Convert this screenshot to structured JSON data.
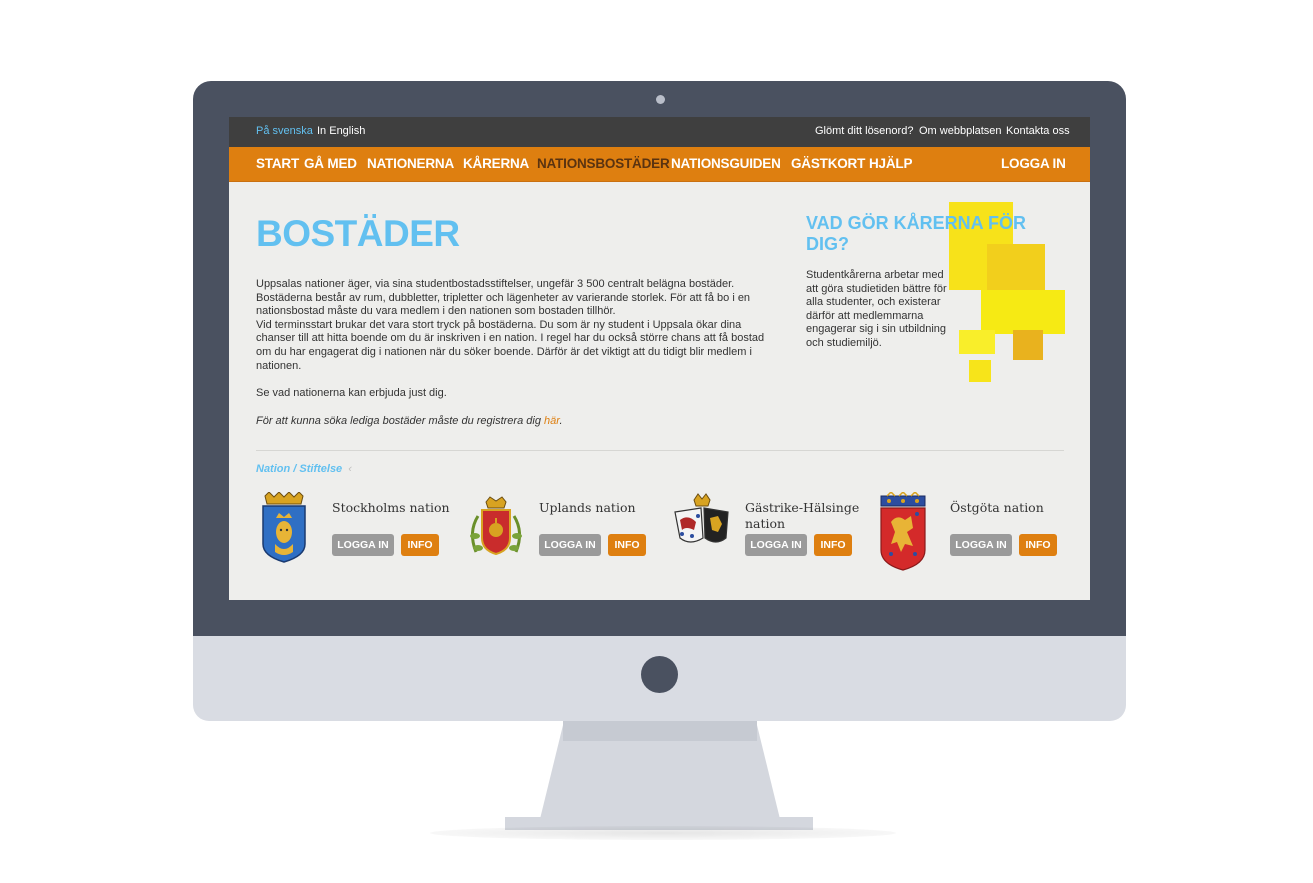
{
  "topbar": {
    "lang_sv": "På svenska",
    "lang_en": "In English",
    "forgot": "Glömt ditt lösenord?",
    "about": "Om webbplatsen",
    "contact": "Kontakta oss"
  },
  "nav": {
    "items": [
      "Start",
      "Gå med",
      "Nationerna",
      "Kårerna",
      "Nationsbostäder",
      "Nationsguiden",
      "Gästkort",
      "Hjälp"
    ],
    "active": "Nationsbostäder",
    "login": "Logga in"
  },
  "page": {
    "title": "BOSTÄDER",
    "intro_1": "Uppsalas nationer äger, via sina studentbostadsstiftelser, ungefär 3 500 centralt belägna bostäder. Bostäderna består av rum, dubbletter, tripletter och lägenheter av varierande storlek. För att få bo i en nationsbostad måste du vara medlem i den nationen som bostaden tillhör.",
    "intro_2": "Vid terminsstart brukar det vara stort tryck på bostäderna. Du som är ny student i Uppsala ökar dina chanser till att hitta boende om du är inskriven i en nation. I regel har du också större chans att få bostad om du har engagerat dig i nationen när du söker boende. Därför är det viktigt att du tidigt blir medlem i nationen.",
    "see_text": "Se vad nationerna kan erbjuda just dig.",
    "register_text": "För att kunna söka lediga bostäder måste du registrera dig ",
    "register_link": "här",
    "register_end": "."
  },
  "aside": {
    "title": "Vad gör kårerna för dig?",
    "text": "Studentkårerna arbetar med att göra studietiden bättre för alla studenter, och existerar därför att medlemmarna engagerar sig i sin utbildning och studiemiljö."
  },
  "nations_section": {
    "label": "Nation / Stiftelse",
    "caret": "‹",
    "login_label": "Logga in",
    "info_label": "Info",
    "items": [
      {
        "name": "Stockholms nation",
        "crest": "stockholm-crest-icon"
      },
      {
        "name": "Uplands nation",
        "crest": "uplands-crest-icon"
      },
      {
        "name": "Gästrike-Hälsinge nation",
        "crest": "gastrike-halsinge-crest-icon"
      },
      {
        "name": "Östgöta nation",
        "crest": "ostgota-crest-icon"
      }
    ]
  },
  "colors": {
    "accent_orange": "#de7f10",
    "accent_blue": "#62c0f0",
    "topbar": "#3f3f3f",
    "button_gray": "#9a9a9a",
    "monitor": "#4a5160"
  }
}
